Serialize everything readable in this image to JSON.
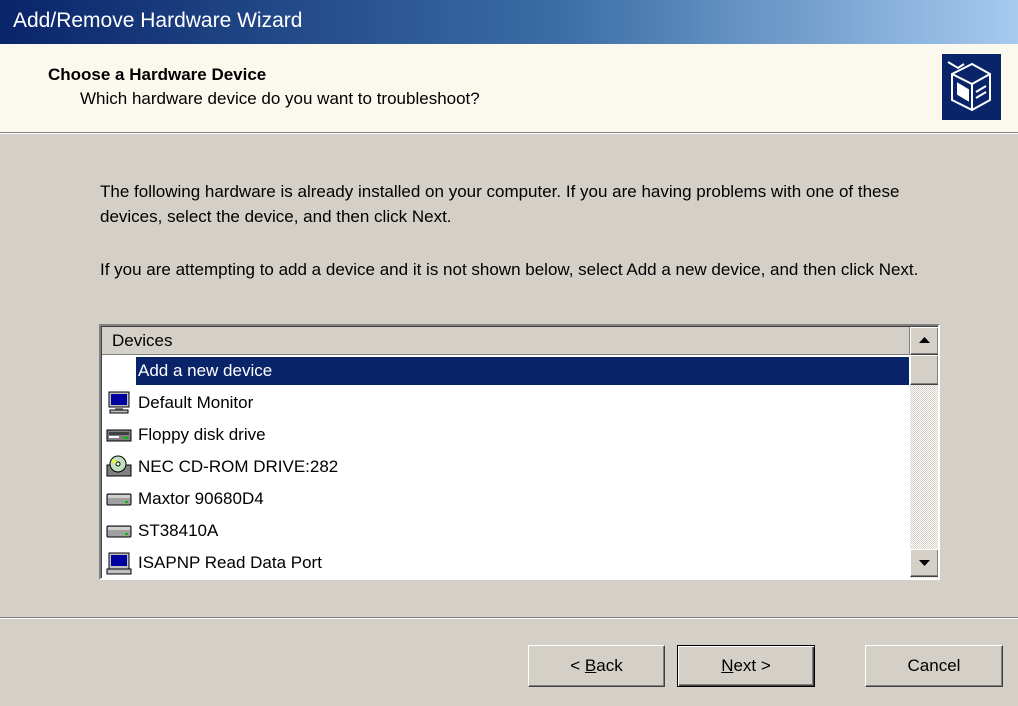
{
  "window": {
    "title": "Add/Remove Hardware Wizard"
  },
  "header": {
    "heading": "Choose a Hardware Device",
    "subheading": "Which hardware device do you want to troubleshoot?",
    "logo_icon": "hardware-wizard-icon"
  },
  "body": {
    "paragraph1": "The following hardware is already installed on your computer. If you are having problems with one of these devices, select the device, and then click Next.",
    "paragraph2": "If you are attempting to add a device and it is not shown below, select Add a new device, and then click Next."
  },
  "device_list": {
    "column_header": "Devices",
    "selected_index": 0,
    "items": [
      {
        "label": "Add a new device",
        "icon": "none"
      },
      {
        "label": "Default Monitor",
        "icon": "monitor-icon"
      },
      {
        "label": "Floppy disk drive",
        "icon": "floppy-drive-icon"
      },
      {
        "label": "NEC CD-ROM DRIVE:282",
        "icon": "cdrom-drive-icon"
      },
      {
        "label": "Maxtor 90680D4",
        "icon": "hard-disk-icon"
      },
      {
        "label": "ST38410A",
        "icon": "hard-disk-icon"
      },
      {
        "label": "ISAPNP Read Data Port",
        "icon": "system-device-icon"
      }
    ]
  },
  "buttons": {
    "back_prefix": "< ",
    "back_accel": "B",
    "back_rest": "ack",
    "next_accel": "N",
    "next_rest": "ext >",
    "cancel": "Cancel"
  },
  "colors": {
    "selection": "#0a246a",
    "face": "#d4d0c8",
    "header_bg": "#fbf8ee"
  }
}
